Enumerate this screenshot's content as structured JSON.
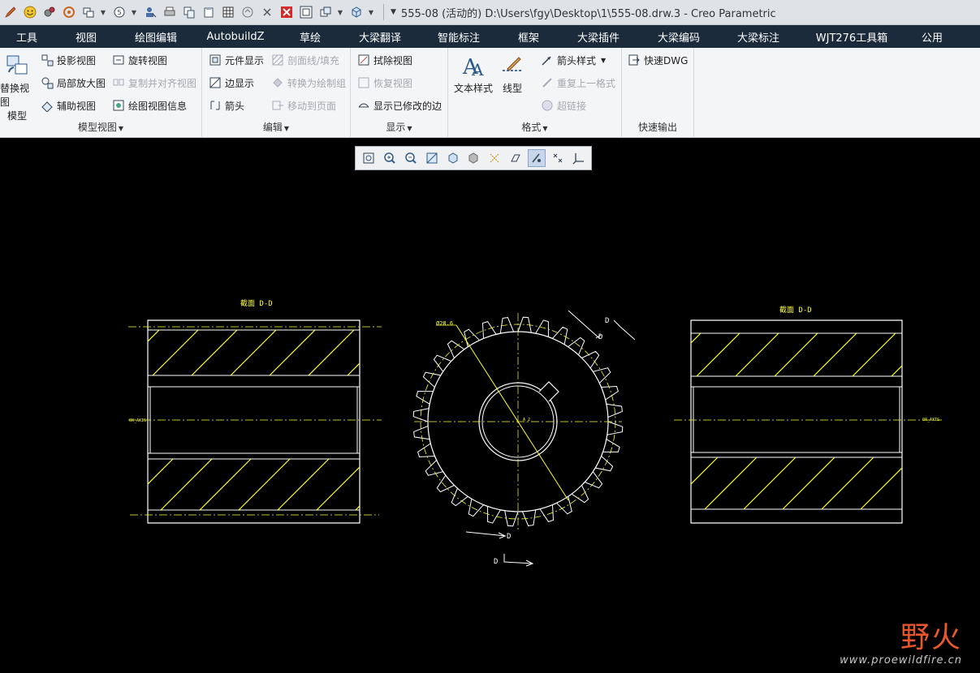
{
  "window": {
    "title": "555-08 (活动的) D:\\Users\\fgy\\Desktop\\1\\555-08.drw.3 - Creo Parametric"
  },
  "quick_access": [
    "pencil-icon",
    "smiley-icon",
    "settings-icon",
    "regenerate-icon",
    "windows-icon",
    "clock-icon",
    "user-icon",
    "print-icon",
    "copy-icon",
    "paste-icon",
    "table-icon",
    "undo-icon",
    "close-icon",
    "close-red-icon",
    "window-icon",
    "window2-icon",
    "cube-icon"
  ],
  "menu": [
    "工具",
    "视图",
    "绘图编辑",
    "AutobuildZ",
    "草绘",
    "大梁翻译",
    "智能标注",
    "框架",
    "大梁插件",
    "大梁编码",
    "大梁标注",
    "WJT276工具箱",
    "公用"
  ],
  "ribbon": {
    "model_views": {
      "label": "模型视图",
      "big_button_line1": "替换视图",
      "big_button_line2": "模型",
      "items": [
        "投影视图",
        "局部放大图",
        "辅助视图",
        "旋转视图",
        "复制并对齐视图",
        "绘图视图信息"
      ]
    },
    "edit": {
      "label": "编辑",
      "items": [
        "元件显示",
        "边显示",
        "箭头",
        "剖面线/填充",
        "转换为绘制组",
        "移动到页面"
      ]
    },
    "display": {
      "label": "显示",
      "items": [
        "拭除视图",
        "恢复视图",
        "显示已修改的边"
      ]
    },
    "format": {
      "label": "格式",
      "text_style": "文本样式",
      "line_style": "线型",
      "items": [
        "箭头样式",
        "重复上一格式",
        "超链接"
      ]
    },
    "quick_output": {
      "label": "快速输出",
      "items": [
        "快速DWG"
      ]
    }
  },
  "view_toolbar": [
    "refit-icon",
    "zoom-in-icon",
    "zoom-out-icon",
    "repaint-icon",
    "saved-views-icon",
    "display-style-icon",
    "datum-display-icon",
    "annotation-display-icon",
    "hidden-line-icon",
    "point-display-icon",
    "csys-display-icon"
  ],
  "drawing": {
    "section_left_label": "截面 D-D",
    "section_right_label": "截面 D-D",
    "gear_diameter_label": "Ø28.6",
    "cut_label": "D",
    "axis_label_left": "OX_AXIS",
    "axis_label_right": "OX_AXIS",
    "center_label": "A_2"
  },
  "watermark": {
    "brand": "野火",
    "url": "www.proewildfire.cn"
  },
  "colors": {
    "menubar_bg": "#1c2b3c",
    "ribbon_bg": "#f4f5f7",
    "canvas_bg": "#000000",
    "drawing_line": "#ffffff",
    "drawing_yellow": "#ffff33",
    "watermark_orange": "#e8582a"
  }
}
